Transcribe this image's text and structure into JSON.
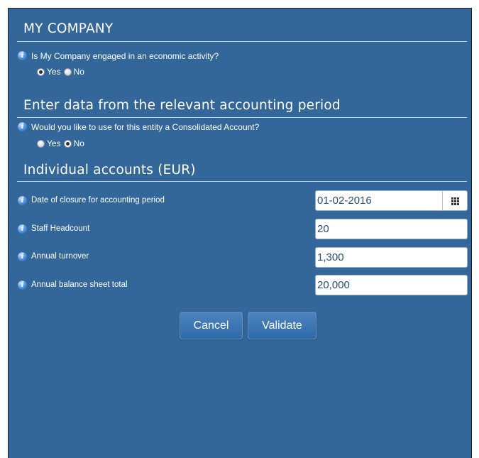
{
  "company": {
    "title": "MY COMPANY",
    "question": "Is My Company engaged in an economic activity?",
    "options": [
      "Yes",
      "No"
    ],
    "selected": "Yes"
  },
  "period": {
    "title": "Enter data from the relevant accounting period",
    "question": "Would you like to use for this entity a Consolidated Account?",
    "options": [
      "Yes",
      "No"
    ],
    "selected": "No"
  },
  "accounts": {
    "title": "Individual accounts (EUR)",
    "fields": [
      {
        "label": "Date of closure for accounting period",
        "value": "01-02-2016"
      },
      {
        "label": "Staff Headcount",
        "value": "20"
      },
      {
        "label": "Annual turnover",
        "value": "1,300"
      },
      {
        "label": "Annual balance sheet total",
        "value": "20,000"
      }
    ]
  },
  "actions": {
    "cancel": "Cancel",
    "validate": "Validate"
  },
  "icons": {
    "info": "info-icon",
    "calendar": "calendar-icon"
  },
  "colors": {
    "panel_background": "#336699",
    "input_text": "#2a4d7a"
  }
}
